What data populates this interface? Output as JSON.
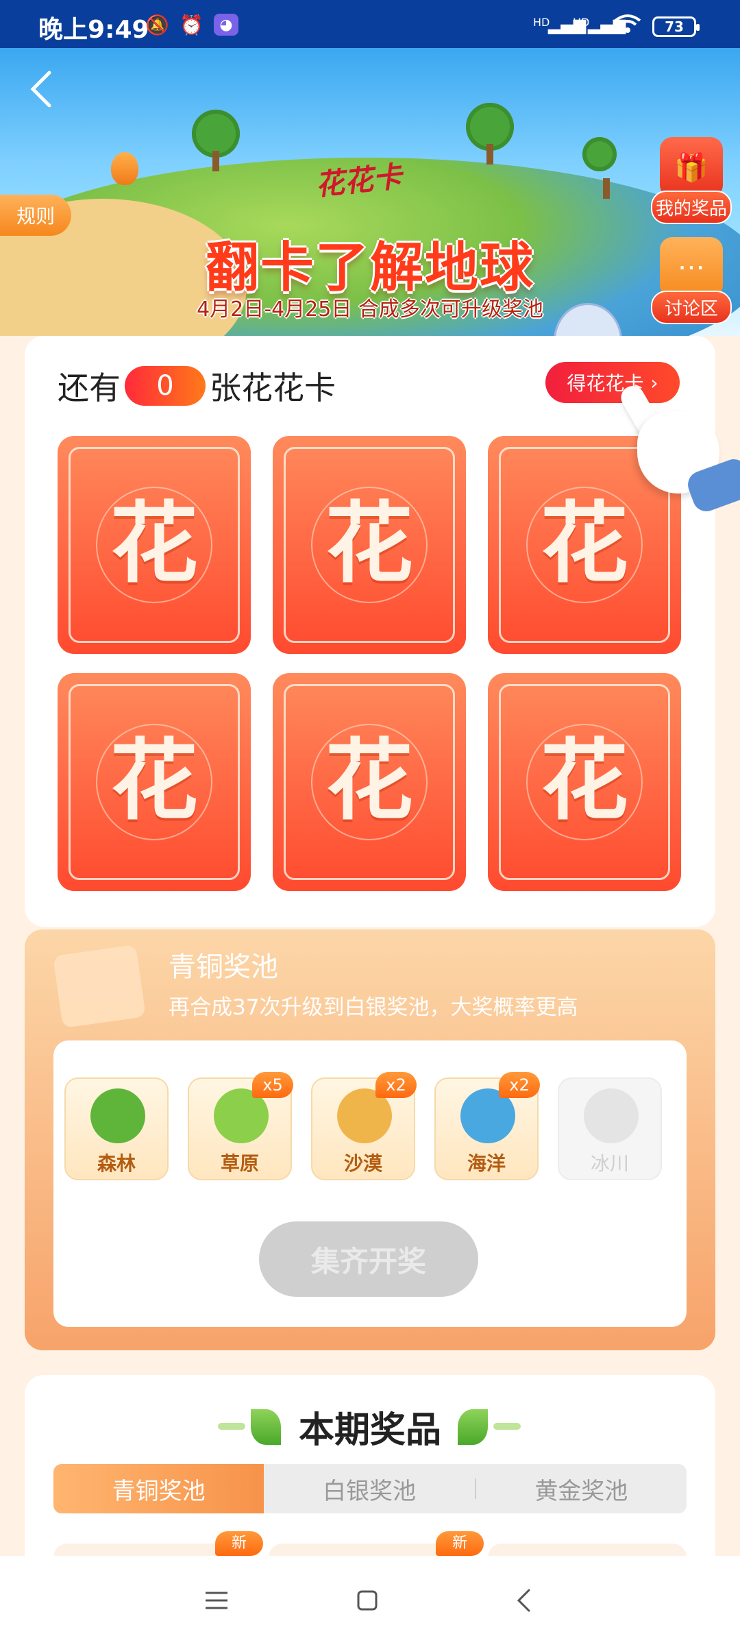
{
  "status_bar": {
    "time": "晚上9:49",
    "network_1": "HD",
    "network_2": "HD",
    "battery": "73"
  },
  "banner": {
    "logo": "花花卡",
    "title": "翻卡了解地球",
    "subtitle": "4月2日-4月25日 合成多次可升级奖池",
    "rules_label": "规则",
    "my_prizes_label": "我的奖品",
    "discussion_label": "讨论区"
  },
  "cards": {
    "remain_prefix": "还有",
    "remain_count": "0",
    "remain_suffix": "张花花卡",
    "get_card_label": "得花花卡",
    "card_glyph": "花"
  },
  "pool": {
    "title": "青铜奖池",
    "description": "再合成37次升级到白银奖池，大奖概率更高",
    "items": [
      {
        "name": "森林",
        "multiplier": "",
        "color": "#5fb53a"
      },
      {
        "name": "草原",
        "multiplier": "x5",
        "color": "#8ccf4a"
      },
      {
        "name": "沙漠",
        "multiplier": "x2",
        "color": "#f0b54a"
      },
      {
        "name": "海洋",
        "multiplier": "x2",
        "color": "#4aa8e0"
      },
      {
        "name": "冰川",
        "multiplier": "",
        "color": "#d8d8d8"
      }
    ],
    "draw_button": "集齐开奖"
  },
  "prizes": {
    "title": "本期奖品",
    "tabs": [
      "青铜奖池",
      "白银奖池",
      "黄金奖池"
    ],
    "new_tag": "新"
  },
  "colors": {
    "accent": "#ff4a2f",
    "pool_orange": "#f7a36a"
  }
}
